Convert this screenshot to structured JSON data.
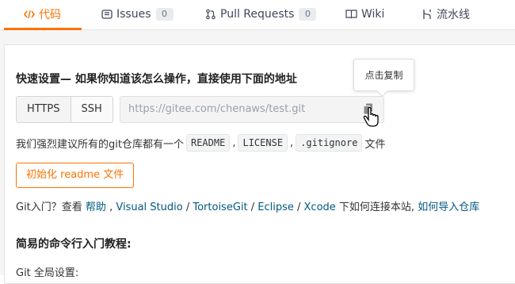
{
  "tabs": [
    {
      "label": "代码",
      "icon": "code-icon",
      "active": true
    },
    {
      "label": "Issues",
      "icon": "issues-icon",
      "count": "0"
    },
    {
      "label": "Pull Requests",
      "icon": "pull-request-icon",
      "count": "0"
    },
    {
      "label": "Wiki",
      "icon": "wiki-book-icon"
    },
    {
      "label": "流水线",
      "icon": "pipeline-icon"
    }
  ],
  "colors": {
    "accent": "#fe7300",
    "link": "#005980"
  },
  "quick_setup": {
    "title": "快速设置— 如果你知道该怎么操作，直接使用下面的地址",
    "tooltip": "点击复制",
    "protocols": [
      "HTTPS",
      "SSH"
    ],
    "url": "https://gitee.com/chenaws/test.git"
  },
  "recommend": {
    "prefix": "我们强烈建议所有的git仓库都有一个",
    "files": [
      "README",
      "LICENSE",
      ".gitignore"
    ],
    "sep1": ",",
    "sep2": ",",
    "suffix": "文件"
  },
  "init_button": "初始化 readme 文件",
  "help": {
    "prefix": "Git入门？查看 ",
    "help_link": "帮助",
    "sep0": " , ",
    "tools": [
      "Visual Studio",
      "TortoiseGit",
      "Eclipse",
      "Xcode"
    ],
    "slash": " / ",
    "middle": " 下如何连接本站, ",
    "import_link": "如何导入仓库"
  },
  "tutorial_title": "简易的命令行入门教程:",
  "global_settings_label": "Git 全局设置:"
}
